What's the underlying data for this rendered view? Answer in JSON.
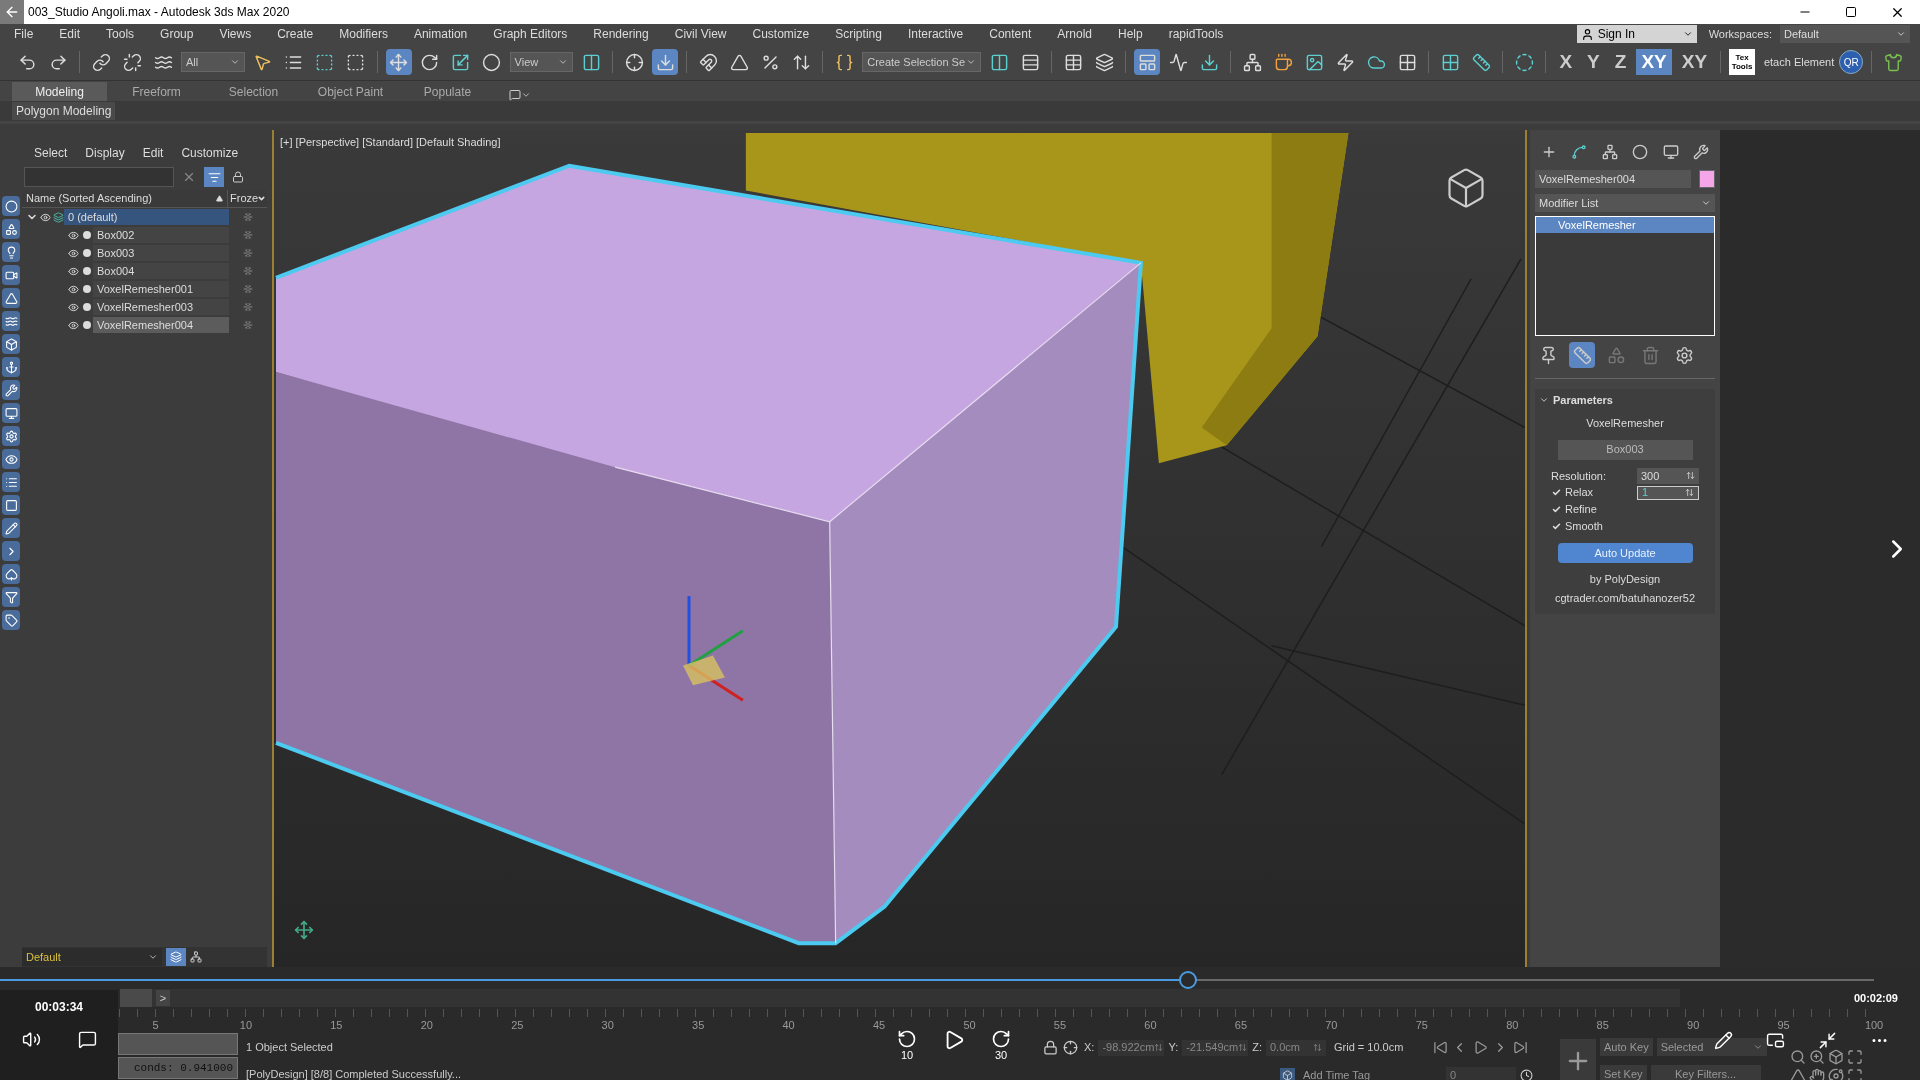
{
  "window": {
    "title": "003_Studio Angoli.max - Autodesk 3ds Max 2020"
  },
  "menu": [
    "File",
    "Edit",
    "Tools",
    "Group",
    "Views",
    "Create",
    "Modifiers",
    "Animation",
    "Graph Editors",
    "Rendering",
    "Civil View",
    "Customize",
    "Scripting",
    "Interactive",
    "Content",
    "Arnold",
    "Help",
    "rapidTools"
  ],
  "account": {
    "sign_in": "Sign In",
    "workspaces_label": "Workspaces:",
    "workspace": "Default"
  },
  "toolbar": {
    "filter": "All",
    "reference": "View",
    "named_selection": "Create Selection Se",
    "move_selected": true,
    "shortcut_override_selected": true,
    "ribbon_toggle_selected": true,
    "axes": [
      {
        "label": "X",
        "selected": false
      },
      {
        "label": "Y",
        "selected": false
      },
      {
        "label": "Z",
        "selected": false
      },
      {
        "label": "XY",
        "selected": true
      },
      {
        "label": "XY",
        "selected": false
      }
    ],
    "textools": "Tex Tools",
    "detach": "etach Element",
    "qr": "QR"
  },
  "ribbon": {
    "tabs": [
      {
        "label": "Modeling",
        "selected": true
      },
      {
        "label": "Freeform",
        "selected": false
      },
      {
        "label": "Selection",
        "selected": false
      },
      {
        "label": "Object Paint",
        "selected": false
      },
      {
        "label": "Populate",
        "selected": false
      }
    ],
    "panel": "Polygon Modeling"
  },
  "scene_explorer": {
    "menu": [
      "Select",
      "Display",
      "Edit",
      "Customize"
    ],
    "columns": [
      "Name (Sorted Ascending)",
      "Froze"
    ],
    "tree": [
      {
        "label": "0 (default)",
        "kind": "layer",
        "expanded": true,
        "selected": true,
        "children": [
          {
            "label": "Box002",
            "kind": "object",
            "selected": false
          },
          {
            "label": "Box003",
            "kind": "object",
            "selected": false
          },
          {
            "label": "Box004",
            "kind": "object",
            "selected": false
          },
          {
            "label": "VoxelRemesher001",
            "kind": "object",
            "selected": false
          },
          {
            "label": "VoxelRemesher003",
            "kind": "object",
            "selected": false
          },
          {
            "label": "VoxelRemesher004",
            "kind": "object",
            "selected": true
          }
        ]
      }
    ],
    "layer": "Default"
  },
  "viewport": {
    "label": "[+] [Perspective] [Standard] [Default Shading]"
  },
  "command_panel": {
    "object_name": "VoxelRemesher004",
    "modifier_list": "Modifier List",
    "stack": [
      {
        "label": "VoxelRemesher",
        "selected": true
      }
    ],
    "rollout": {
      "title": "Parameters",
      "heading": "VoxelRemesher",
      "source_button": "Box003",
      "resolution_label": "Resolution:",
      "resolution": "300",
      "options": [
        {
          "label": "Relax",
          "checked": true,
          "value": "1"
        },
        {
          "label": "Refine",
          "checked": true
        },
        {
          "label": "Smooth",
          "checked": true
        }
      ],
      "auto_update": "Auto Update",
      "credit": "by PolyDesign",
      "link": "cgtrader.com/batuhanozer52"
    }
  },
  "timeline": {
    "time_slider": {
      "level": 0
    },
    "ticks": [
      "5",
      "10",
      "15",
      "20",
      "25",
      "30",
      "35",
      "40",
      "45",
      "50",
      "55",
      "60",
      "65",
      "70",
      "75",
      "80",
      "85",
      "90",
      "95",
      "100"
    ],
    "next": ">"
  },
  "status": {
    "listener": "conds: 0.941000",
    "selection": "1 Object Selected",
    "prompt": "[PolyDesign] [8/8] Completed Successfully...",
    "x": "-98.922cm",
    "y": "-21.549cm",
    "z": "0.0cm",
    "x_label": "X:",
    "y_label": "Y:",
    "z_label": "Z:",
    "grid": "Grid = 10.0cm",
    "add_time_tag": "Add Time Tag",
    "frame": "0",
    "auto_key": "Auto Key",
    "key_set": "Selected",
    "set_key": "Set Key",
    "key_filters": "Key Filters..."
  },
  "video_player": {
    "elapsed": "00:03:34",
    "remaining": "00:02:09",
    "level": 0.634,
    "rewind": "10",
    "forward": "30"
  }
}
